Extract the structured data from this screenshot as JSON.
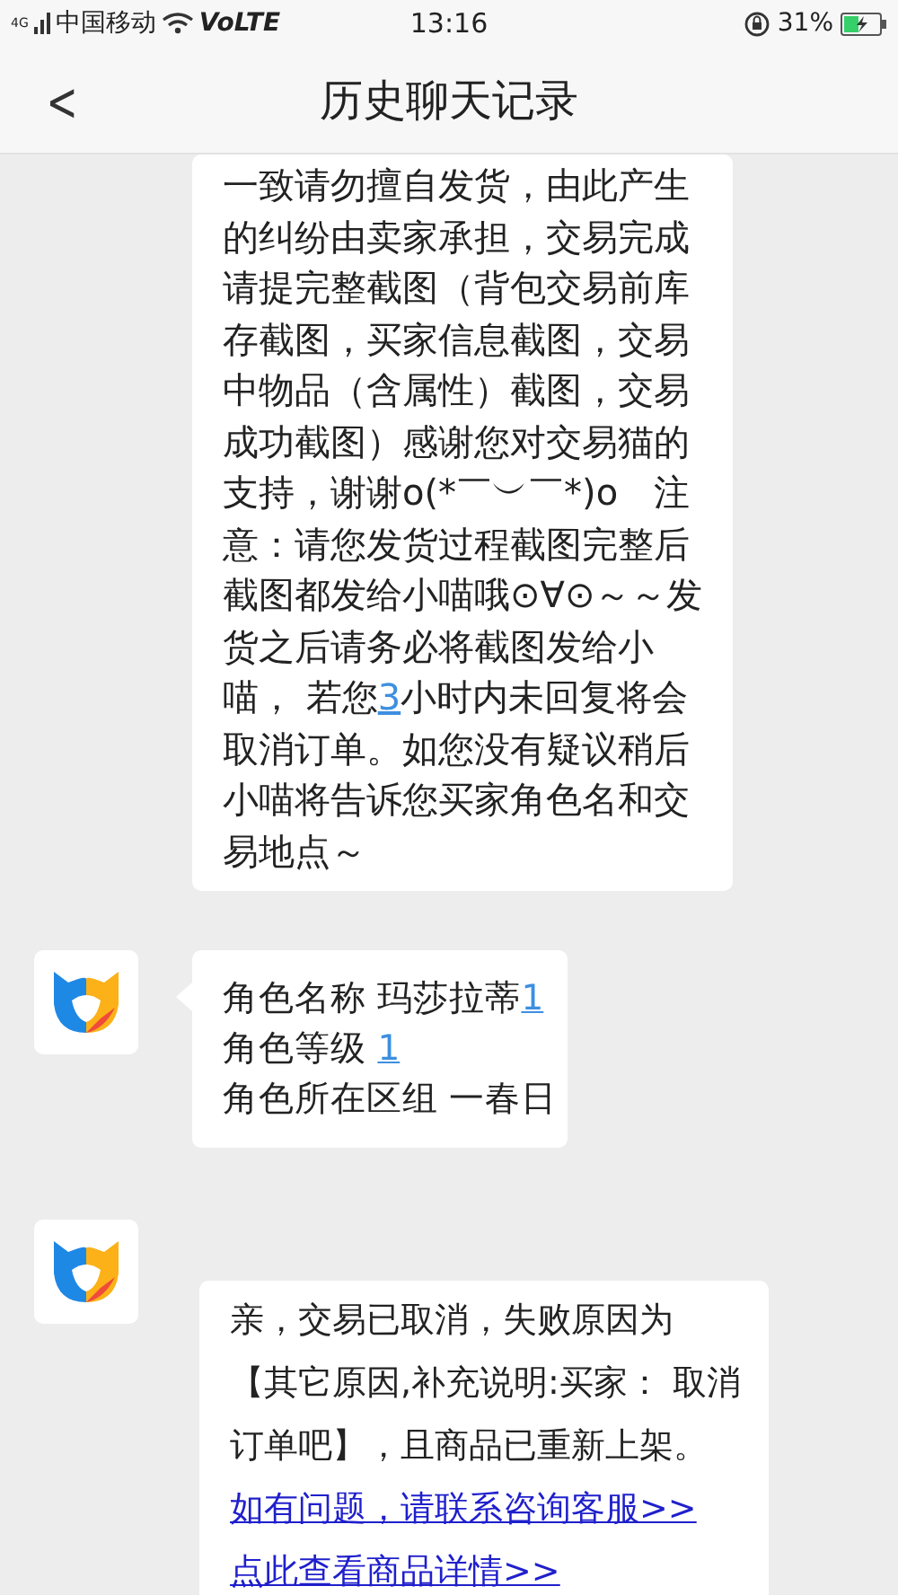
{
  "status_bar": {
    "network": "4G",
    "carrier": "中国移动",
    "volte": "VoLTE",
    "time": "13:16",
    "battery": "31%"
  },
  "header": {
    "back": "<",
    "title": "历史聊天记录"
  },
  "messages": [
    {
      "avatar": false,
      "tail": false,
      "paragraphs": [
        {
          "kind": "text",
          "parts": [
            {
              "text": "一致请勿擅自发货，由此产生的纠纷由卖家承担，交易完成请提完整截图（背包交易前库存截图，买家信息截图，交易中物品（含属性）截图，交易成功截图）感谢您对交易猫的支持，谢谢o(*￣︶￣*)o　注意：请您发货过程截图完整后截图都发给小喵哦⊙∀⊙～～发货之后请务必将截图发给小喵， 若您",
              "link": false
            },
            {
              "text": "3",
              "link": true
            },
            {
              "text": "小时内未回复将会取消订单。如您没有疑议稍后小喵将告诉您买家角色名和交易地点～",
              "link": false
            }
          ]
        }
      ]
    },
    {
      "avatar": true,
      "tail": true,
      "paragraphs": [
        {
          "kind": "text",
          "parts": [
            {
              "text": "角色名称 玛莎拉蒂",
              "link": false
            },
            {
              "text": "1",
              "link": true
            }
          ]
        },
        {
          "kind": "text",
          "parts": [
            {
              "text": "角色等级 ",
              "link": false
            },
            {
              "text": "1",
              "link": true
            }
          ]
        },
        {
          "kind": "text",
          "parts": [
            {
              "text": "角色所在区组 一春日",
              "link": false
            }
          ]
        }
      ]
    },
    {
      "avatar": true,
      "tail": false,
      "paragraphs": [
        {
          "kind": "text",
          "parts": [
            {
              "text": "亲，交易已取消，失败原因为",
              "link": false
            }
          ]
        },
        {
          "kind": "text",
          "parts": [
            {
              "text": "【其它原因,补充说明:买家： 取消",
              "link": false
            }
          ]
        },
        {
          "kind": "text",
          "parts": [
            {
              "text": "订单吧】，且商品已重新上架。",
              "link": false
            }
          ]
        },
        {
          "kind": "link",
          "text": "如有问题，请联系咨询客服>>"
        },
        {
          "kind": "link",
          "text": "点此查看商品详情>>"
        }
      ]
    }
  ]
}
